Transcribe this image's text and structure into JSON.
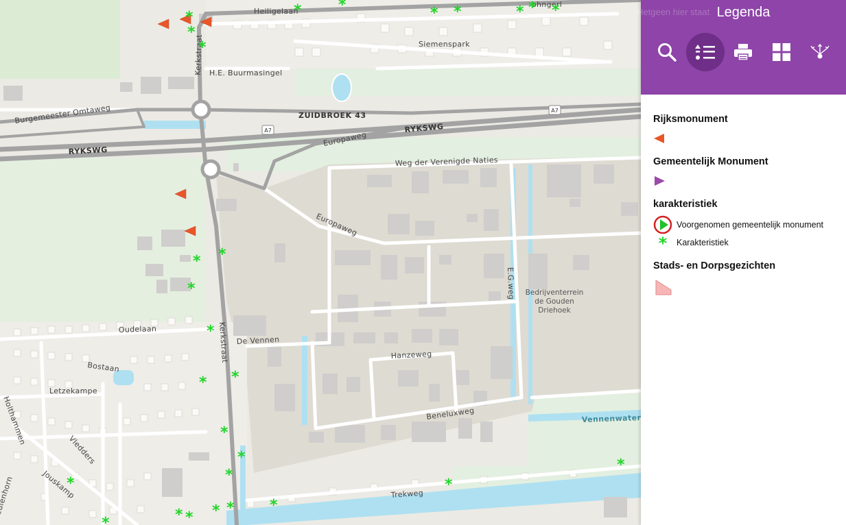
{
  "panel": {
    "title": "Legenda",
    "faded_header_text": "Hetgeen hier staat",
    "toolbar": [
      {
        "icon": "search-icon",
        "active": false
      },
      {
        "icon": "legend-list-icon",
        "active": true
      },
      {
        "icon": "print-icon",
        "active": false
      },
      {
        "icon": "basemap-grid-icon",
        "active": false
      },
      {
        "icon": "share-icon",
        "active": false
      }
    ]
  },
  "legend": {
    "groups": [
      {
        "title": "Rijksmonument",
        "items": [
          {
            "label": "",
            "symbol": "orange-left-triangle",
            "color": "#e8562a"
          }
        ]
      },
      {
        "title": "Gemeentelijk Monument",
        "items": [
          {
            "label": "",
            "symbol": "purple-right-triangle",
            "color": "#9a4aa8"
          }
        ]
      },
      {
        "title": "karakteristiek",
        "items": [
          {
            "label": "Voorgenomen gemeentelijk monument",
            "symbol": "green-play-in-red-circle",
            "color": "#22c12a"
          },
          {
            "label": "Karakteristiek",
            "symbol": "green-asterisk",
            "color": "#22d52a"
          }
        ]
      },
      {
        "title": "Stads- en Dorpsgezichten",
        "items": [
          {
            "label": "",
            "symbol": "pink-polygon",
            "color": "#f7b6b6"
          }
        ]
      }
    ]
  },
  "map": {
    "labels": {
      "heiligelaan": "Heiligelaan",
      "siemenspark": "Siemenspark",
      "kerkstraat_north": "Kerkstraat",
      "buurmasingel": "H.E. Buurmasingel",
      "burgemeester_omtaweg": "Burgemeester Omtaweg",
      "zuidbroek43": "ZUIDBROEK 43",
      "a7_east": "A7",
      "a7_west": "A7",
      "rykswg_east": "RYKSWG",
      "rykswg_west": "RYKSWG",
      "europaweg_north": "Europaweg",
      "weg_der_verenigde_naties": "Weg der Verenigde Naties",
      "europaweg_south": "Europaweg",
      "egweg": "E.G.weg",
      "bedrijventerrein_1": "Bedrijventerrein",
      "bedrijventerrein_2": "de Gouden",
      "bedrijventerrein_3": "Driehoek",
      "oudelaan": "Oudelaan",
      "de_vennen": "De Vennen",
      "kerkstraat_south": "Kerkstraat",
      "hanzeweg": "Hanzeweg",
      "bostaan": "Bostaan",
      "letzekampe": "Letzekampe",
      "beneluxweg": "Beneluxweg",
      "vennenwatering": "Vennenwatering",
      "vledders": "Vledders",
      "jouskamp": "Jouskamp",
      "eulenhorn": "eulenhorn",
      "holthammen": "Holthammen",
      "trekweg": "Trekweg",
      "faded_corner": "ohngerl"
    },
    "colors": {
      "background": "#eceae4",
      "industrial": "#dedbd2",
      "green": "#e3efe0",
      "water": "#aee0f1",
      "road_main": "#a3a3a3",
      "road_minor": "#ffffff",
      "building": "#d0cecc"
    }
  }
}
